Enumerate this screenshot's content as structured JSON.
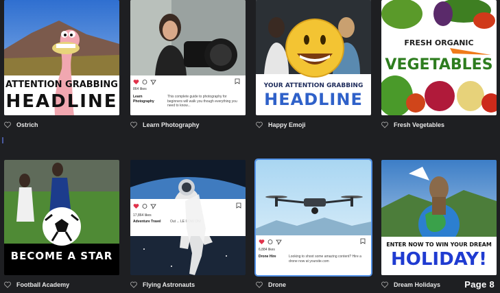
{
  "cards": [
    {
      "caption": "Ostrich",
      "headline_top": "ATTENTION GRABBING",
      "headline_bottom": "HEADLINE"
    },
    {
      "caption": "Learn Photography",
      "likes": "864 likes",
      "post_name": "Learn Photography",
      "post_text": "This complete guide to photography for beginners will walk you though everything you need to know..."
    },
    {
      "caption": "Happy Emoji",
      "headline_top": "YOUR ATTENTION GRABBING",
      "headline_bottom": "HEADLINE"
    },
    {
      "caption": "Fresh Vegetables",
      "headline_top": "FRESH ORGANIC",
      "headline_bottom": "VEGETABLES"
    },
    {
      "caption": "Football Academy",
      "headline": "BECOME A STAR"
    },
    {
      "caption": "Flying Astronauts",
      "likes": "17,864 likes",
      "post_name": "Adventure Travel",
      "post_text": "Out ... LE NOW ON!"
    },
    {
      "caption": "Drone",
      "likes": "6,884 likes",
      "post_name": "Drone Hire",
      "post_text": "Looking to shoot some amazing content? Hire a drone now at yoursite.com"
    },
    {
      "caption": "Dream Holidays",
      "headline_top": "ENTER NOW TO WIN YOUR DREAM",
      "headline_bottom": "HOLIDAY!"
    }
  ],
  "page_label": "Page 8",
  "colors": {
    "background": "#1e1f22",
    "selection": "#4f8fe6",
    "heart": "#e0334c"
  }
}
